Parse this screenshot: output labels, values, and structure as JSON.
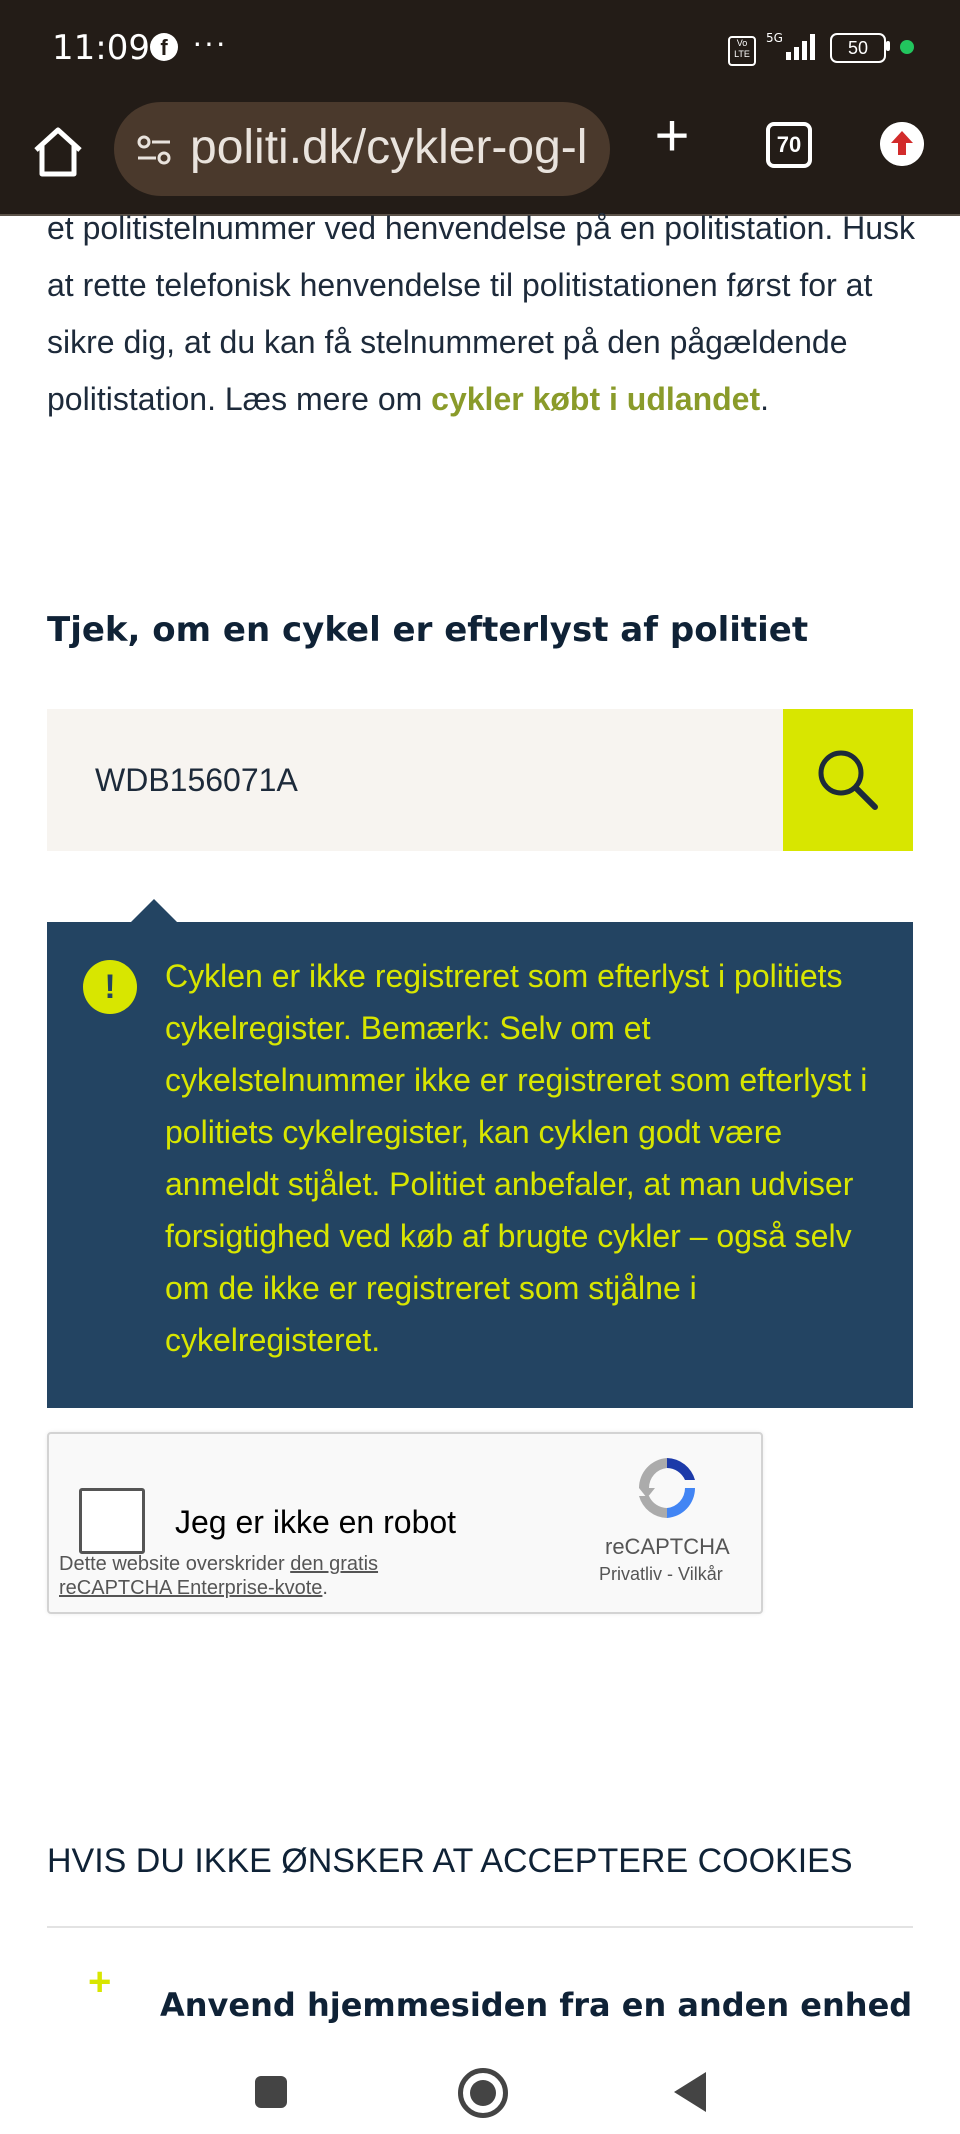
{
  "status_bar": {
    "time": "11:09",
    "network": "5G",
    "volte": "Vo LTE",
    "battery": "50"
  },
  "browser": {
    "url": "politi.dk/cykler-og-l",
    "tab_count": "70"
  },
  "article": {
    "text_before_link": "et politistelnummer ved henvendelse på en politistation. Husk at rette telefonisk henvendelse til politistationen først for at sikre dig, at du kan få stelnummeret på den pågældende politistation. Læs mere om ",
    "link_text": "cykler købt i udlandet",
    "text_after_link": "."
  },
  "search": {
    "title": "Tjek, om en cykel er efterlyst af politiet",
    "value": "WDB156071A"
  },
  "alert": {
    "icon_text": "!",
    "message": "Cyklen er ikke registreret som efterlyst i politiets cykelregister. Bemærk: Selv om et cykelstelnummer ikke er registreret som efterlyst i politiets cykelregister, kan cyklen godt være anmeldt stjålet. Politiet anbefaler, at man udviser forsigtighed ved køb af brugte cykler – også selv om de ikke er registreret som stjålne i cykelregisteret."
  },
  "captcha": {
    "label": "Jeg er ikke en robot",
    "brand": "reCAPTCHA",
    "privacy": "Privatliv",
    "separator": " - ",
    "terms": "Vilkår",
    "notice_prefix": "Dette website overskrider ",
    "notice_link_1": "den gratis",
    "notice_link_2": "reCAPTCHA Enterprise-kvote",
    "notice_suffix": "."
  },
  "cookies": {
    "title": "HVIS DU IKKE ØNSKER AT ACCEPTERE COOKIES",
    "accordion_icon": "+",
    "accordion_title": "Anvend hjemmesiden fra en anden enhed"
  },
  "colors": {
    "accent_yellow": "#d8e600",
    "navy": "#234462",
    "link_olive": "#8a9b2a"
  }
}
